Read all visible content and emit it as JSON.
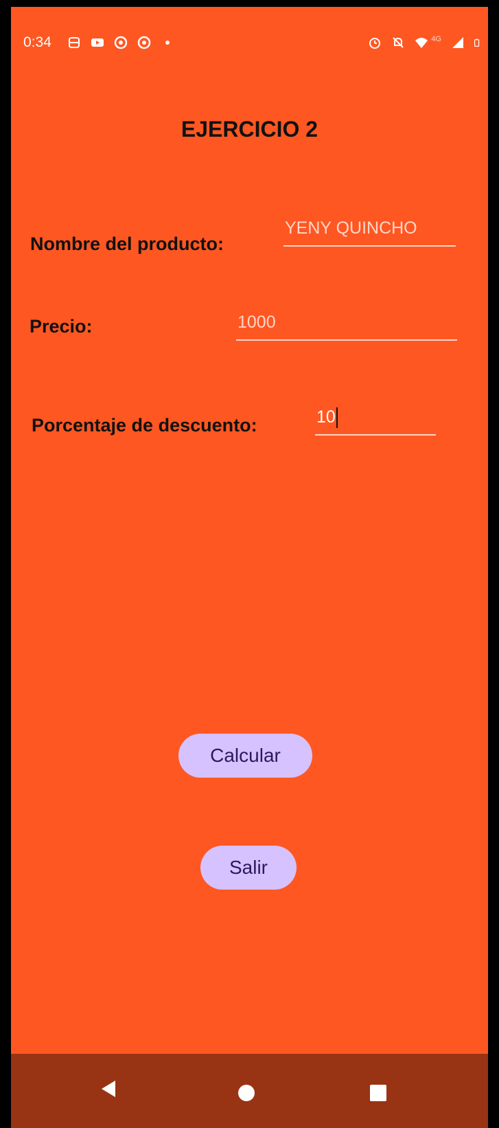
{
  "status_bar": {
    "time": "0:34",
    "left_icons": [
      "notification-icon",
      "youtube-icon",
      "chrome-icon",
      "chrome-icon",
      "dot-icon"
    ],
    "right_icons": [
      "alarm-icon",
      "mute-icon",
      "wifi-icon",
      "signal-icon",
      "battery-icon"
    ],
    "network_label": "4G"
  },
  "screen": {
    "title": "EJERCICIO 2",
    "fields": {
      "product_name": {
        "label": "Nombre del producto:",
        "value": "YENY QUINCHO"
      },
      "price": {
        "label": "Precio:",
        "value": "1000"
      },
      "discount": {
        "label": "Porcentaje de descuento:",
        "value": "10"
      }
    },
    "buttons": {
      "calculate": "Calcular",
      "exit": "Salir"
    }
  },
  "colors": {
    "background": "#ff5722",
    "nav_bar": "#983414",
    "button": "#d6c2ff",
    "button_text": "#2a1a5e"
  }
}
